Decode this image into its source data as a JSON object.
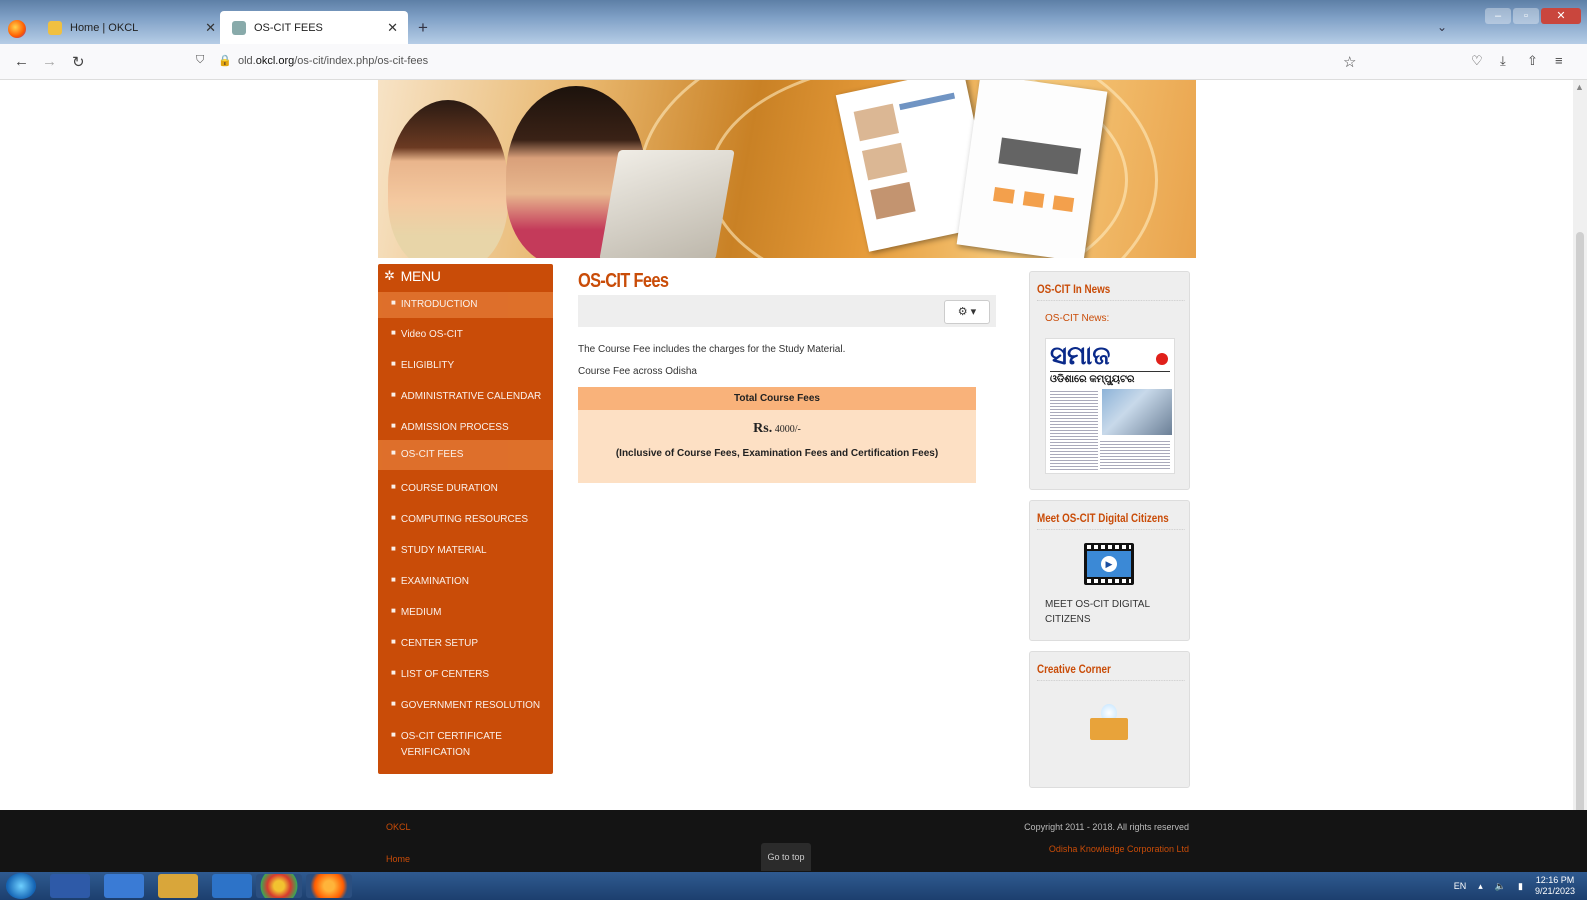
{
  "browser": {
    "tabs": [
      {
        "label": "Home | OKCL",
        "active": false
      },
      {
        "label": "OS-CIT FEES",
        "active": true
      }
    ],
    "url_prefix": "old.",
    "url_domain": "okcl.org",
    "url_path": "/os-cit/index.php/os-cit-fees"
  },
  "menu": {
    "title": "MENU",
    "items": [
      {
        "label": "INTRODUCTION",
        "highlight": true
      },
      {
        "label": "Video OS-CIT",
        "highlight": false
      },
      {
        "label": "ELIGIBLITY",
        "highlight": false
      },
      {
        "label": "ADMINISTRATIVE CALENDAR",
        "highlight": false
      },
      {
        "label": "ADMISSION PROCESS",
        "highlight": false
      },
      {
        "label": "OS-CIT FEES",
        "highlight": true
      },
      {
        "label": "COURSE DURATION",
        "highlight": false
      },
      {
        "label": "COMPUTING RESOURCES",
        "highlight": false
      },
      {
        "label": "STUDY MATERIAL",
        "highlight": false
      },
      {
        "label": "EXAMINATION",
        "highlight": false
      },
      {
        "label": "MEDIUM",
        "highlight": false
      },
      {
        "label": "CENTER SETUP",
        "highlight": false
      },
      {
        "label": "LIST OF CENTERS",
        "highlight": false
      },
      {
        "label": "GOVERNMENT RESOLUTION",
        "highlight": false
      },
      {
        "label": "OS-CIT CERTIFICATE VERIFICATION",
        "highlight": false
      }
    ]
  },
  "main": {
    "title": "OS-CIT Fees",
    "tool_button": "⚙ ▾",
    "para1": "The Course Fee includes the charges for the Study Material.",
    "para2": "Course Fee across Odisha",
    "fee_header": "Total Course Fees",
    "fee_currency": "Rs.",
    "fee_amount": "4000/-",
    "fee_note": "(Inclusive of Course Fees, Examination Fees and Certification Fees)"
  },
  "sidebar": {
    "news_title": "OS-CIT In News",
    "news_sub": "OS-CIT News:",
    "news_masthead": "ସମାଜ",
    "news_headline": "ଓଡିଶାରେ କମ୍ପ୍ୟୁଟର",
    "citizens_title": "Meet OS-CIT Digital Citizens",
    "citizens_caption": "MEET OS-CIT DIGITAL CITIZENS",
    "creative_title": "Creative Corner"
  },
  "footer": {
    "link1": "OKCL",
    "link2": "Home",
    "go_top": "Go to top",
    "copyright": "Copyright 2011 - 2018. All rights reserved",
    "corp": "Odisha Knowledge Corporation Ltd"
  },
  "taskbar": {
    "lang": "EN",
    "time": "12:16 PM",
    "date": "9/21/2023"
  },
  "colors": {
    "brand_orange": "#c94c08",
    "menu_highlight": "#e0732e",
    "fee_header": "#f9b27a",
    "fee_body": "#fde0c4"
  }
}
